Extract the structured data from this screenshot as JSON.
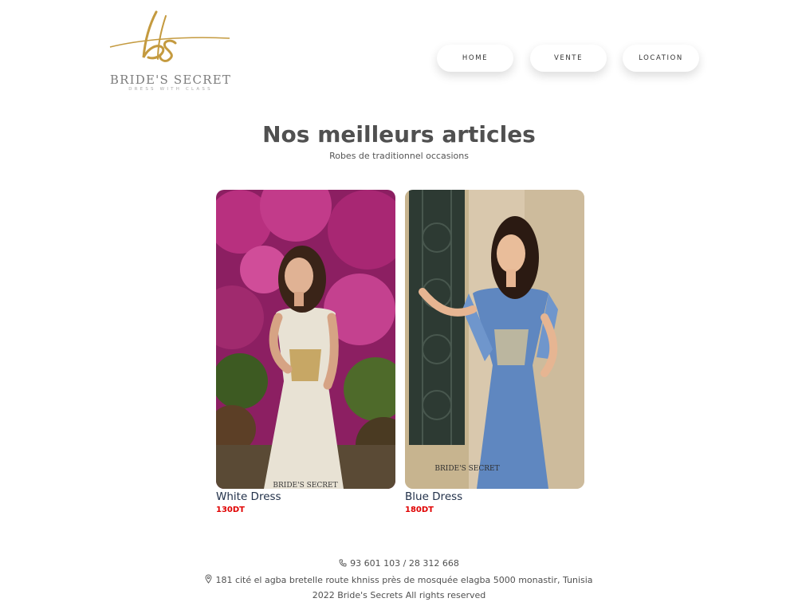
{
  "header": {
    "logo": {
      "monogram": "bs",
      "name": "BRIDE'S SECRET",
      "tagline": "DRESS WITH CLASS"
    },
    "nav": [
      {
        "label": "HOME"
      },
      {
        "label": "VENTE"
      },
      {
        "label": "LOCATION"
      }
    ]
  },
  "main": {
    "title": "Nos meilleurs articles",
    "subtitle": "Robes de traditionnel occasions",
    "products": [
      {
        "name": "White Dress",
        "price": "130DT",
        "watermark": "BRIDE'S SECRET"
      },
      {
        "name": "Blue Dress",
        "price": "180DT",
        "watermark": "BRIDE'S SECRET"
      }
    ]
  },
  "footer": {
    "phone_icon": "phone-icon",
    "phone": "93 601 103 / 28 312 668",
    "location_icon": "map-pin-icon",
    "address": "181 cité el agba bretelle route khniss près de mosquée elagba 5000 monastir, Tunisia",
    "copyright": "2022 Bride's Secrets All rights reserved"
  },
  "colors": {
    "brand_gold": "#c49a3f",
    "price_red": "#e00000",
    "product_name": "#22314a",
    "text_gray": "#505050"
  }
}
